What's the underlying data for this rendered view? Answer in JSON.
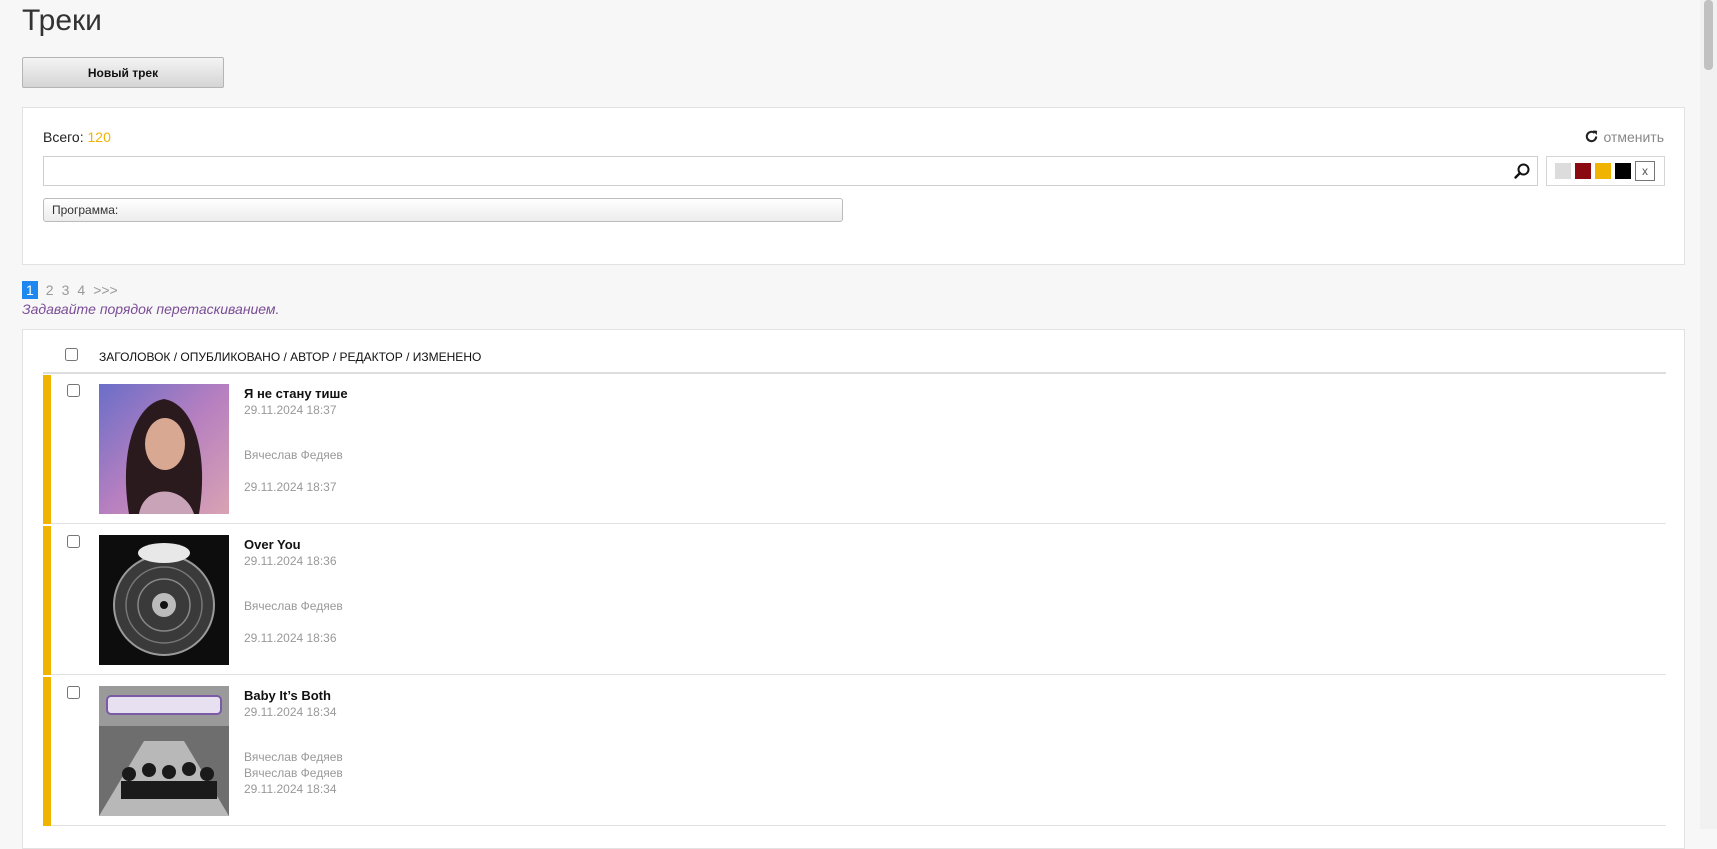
{
  "page": {
    "title": "Треки"
  },
  "toolbar": {
    "new_track_label": "Новый трек"
  },
  "filter": {
    "total_label": "Всего:",
    "total_count": "120",
    "cancel_label": "отменить",
    "search_value": "",
    "program_label": "Программа:",
    "color_filters": [
      "#dcdcdc",
      "#8b0a12",
      "#f0b400",
      "#000000"
    ],
    "reset_label": "x"
  },
  "pagination": {
    "pages": [
      "1",
      "2",
      "3",
      "4"
    ],
    "next_label": ">>>",
    "current": "1"
  },
  "hint": "Задавайте порядок перетаскиванием.",
  "list": {
    "header": "ЗАГОЛОВОК / ОПУБЛИКОВАНО / АВТОР / РЕДАКТОР / ИЗМЕНЕНО",
    "rows": [
      {
        "title": "Я не стану тише",
        "published": "29.11.2024 18:37",
        "author": "Вячеслав Федяев",
        "editor": "",
        "modified": "29.11.2024 18:37",
        "marker_color": "#f0b400"
      },
      {
        "title": "Over You",
        "published": "29.11.2024 18:36",
        "author": "Вячеслав Федяев",
        "editor": "",
        "modified": "29.11.2024 18:36",
        "marker_color": "#f0b400"
      },
      {
        "title": "Baby It’s Both",
        "published": "29.11.2024 18:34",
        "author": "Вячеслав Федяев",
        "editor": "Вячеслав Федяев",
        "modified": "29.11.2024 18:34",
        "marker_color": "#f0b400"
      }
    ]
  }
}
